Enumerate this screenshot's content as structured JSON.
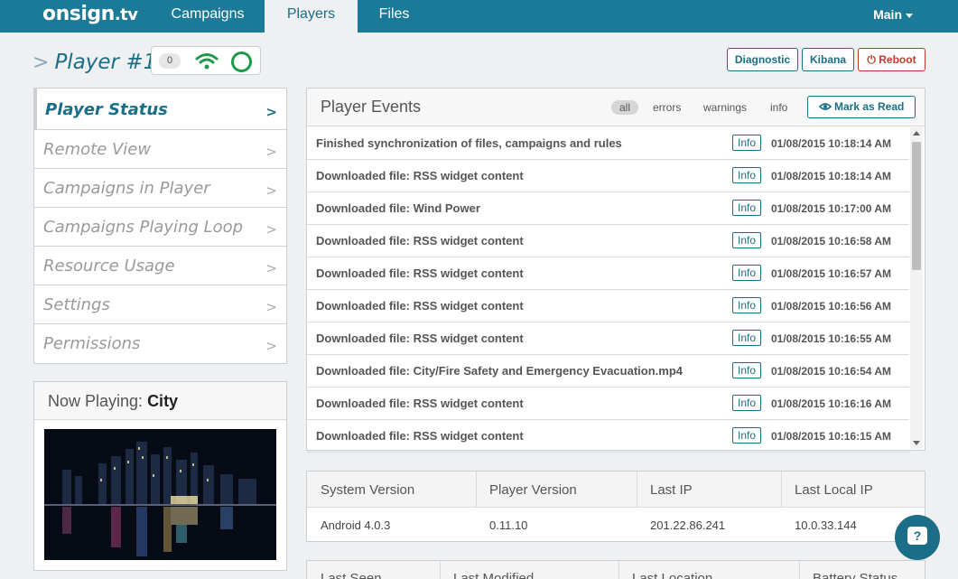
{
  "nav": {
    "logo_main": "onsign",
    "logo_tv": ".tv",
    "tabs": [
      {
        "label": "Campaigns"
      },
      {
        "label": "Players"
      },
      {
        "label": "Files"
      }
    ],
    "main_menu": "Main"
  },
  "player": {
    "title": "Player #1",
    "badge_count": "0"
  },
  "actions": {
    "diagnostic": "Diagnostic",
    "kibana": "Kibana",
    "reboot": "Reboot"
  },
  "sidebar": {
    "items": [
      {
        "label": "Player Status"
      },
      {
        "label": "Remote View"
      },
      {
        "label": "Campaigns in Player"
      },
      {
        "label": "Campaigns Playing Loop"
      },
      {
        "label": "Resource Usage"
      },
      {
        "label": "Settings"
      },
      {
        "label": "Permissions"
      }
    ],
    "arrow": ">"
  },
  "now_playing": {
    "label": "Now Playing: ",
    "value": "City"
  },
  "events": {
    "title": "Player Events",
    "filters": [
      "all",
      "errors",
      "warnings",
      "info"
    ],
    "mark_read": "Mark as Read",
    "rows": [
      {
        "text": "Finished synchronization of files, campaigns and rules",
        "badge": "Info",
        "time": "01/08/2015 10:18:14 AM"
      },
      {
        "text": "Downloaded file: RSS widget content",
        "badge": "Info",
        "time": "01/08/2015 10:18:14 AM"
      },
      {
        "text": "Downloaded file: Wind Power",
        "badge": "Info",
        "time": "01/08/2015 10:17:00 AM"
      },
      {
        "text": "Downloaded file: RSS widget content",
        "badge": "Info",
        "time": "01/08/2015 10:16:58 AM"
      },
      {
        "text": "Downloaded file: RSS widget content",
        "badge": "Info",
        "time": "01/08/2015 10:16:57 AM"
      },
      {
        "text": "Downloaded file: RSS widget content",
        "badge": "Info",
        "time": "01/08/2015 10:16:56 AM"
      },
      {
        "text": "Downloaded file: RSS widget content",
        "badge": "Info",
        "time": "01/08/2015 10:16:55 AM"
      },
      {
        "text": "Downloaded file: City/Fire Safety and Emergency Evacuation.mp4",
        "badge": "Info",
        "time": "01/08/2015 10:16:54 AM"
      },
      {
        "text": "Downloaded file: RSS widget content",
        "badge": "Info",
        "time": "01/08/2015 10:16:16 AM"
      },
      {
        "text": "Downloaded file: RSS widget content",
        "badge": "Info",
        "time": "01/08/2015 10:16:15 AM"
      }
    ]
  },
  "system_info": {
    "headers": [
      "System Version",
      "Player Version",
      "Last IP",
      "Last Local IP"
    ],
    "values": [
      "Android 4.0.3",
      "0.11.10",
      "201.22.86.241",
      "10.0.33.144"
    ]
  },
  "system_info2": {
    "headers": [
      "Last Seen",
      "Last Modified",
      "Last Location",
      "Battery Status"
    ]
  },
  "help": {
    "icon": "?"
  },
  "colors": {
    "brand": "#1b7a97",
    "accent": "#1b6e88",
    "online": "#1c9a4a",
    "danger": "#c0392b"
  }
}
